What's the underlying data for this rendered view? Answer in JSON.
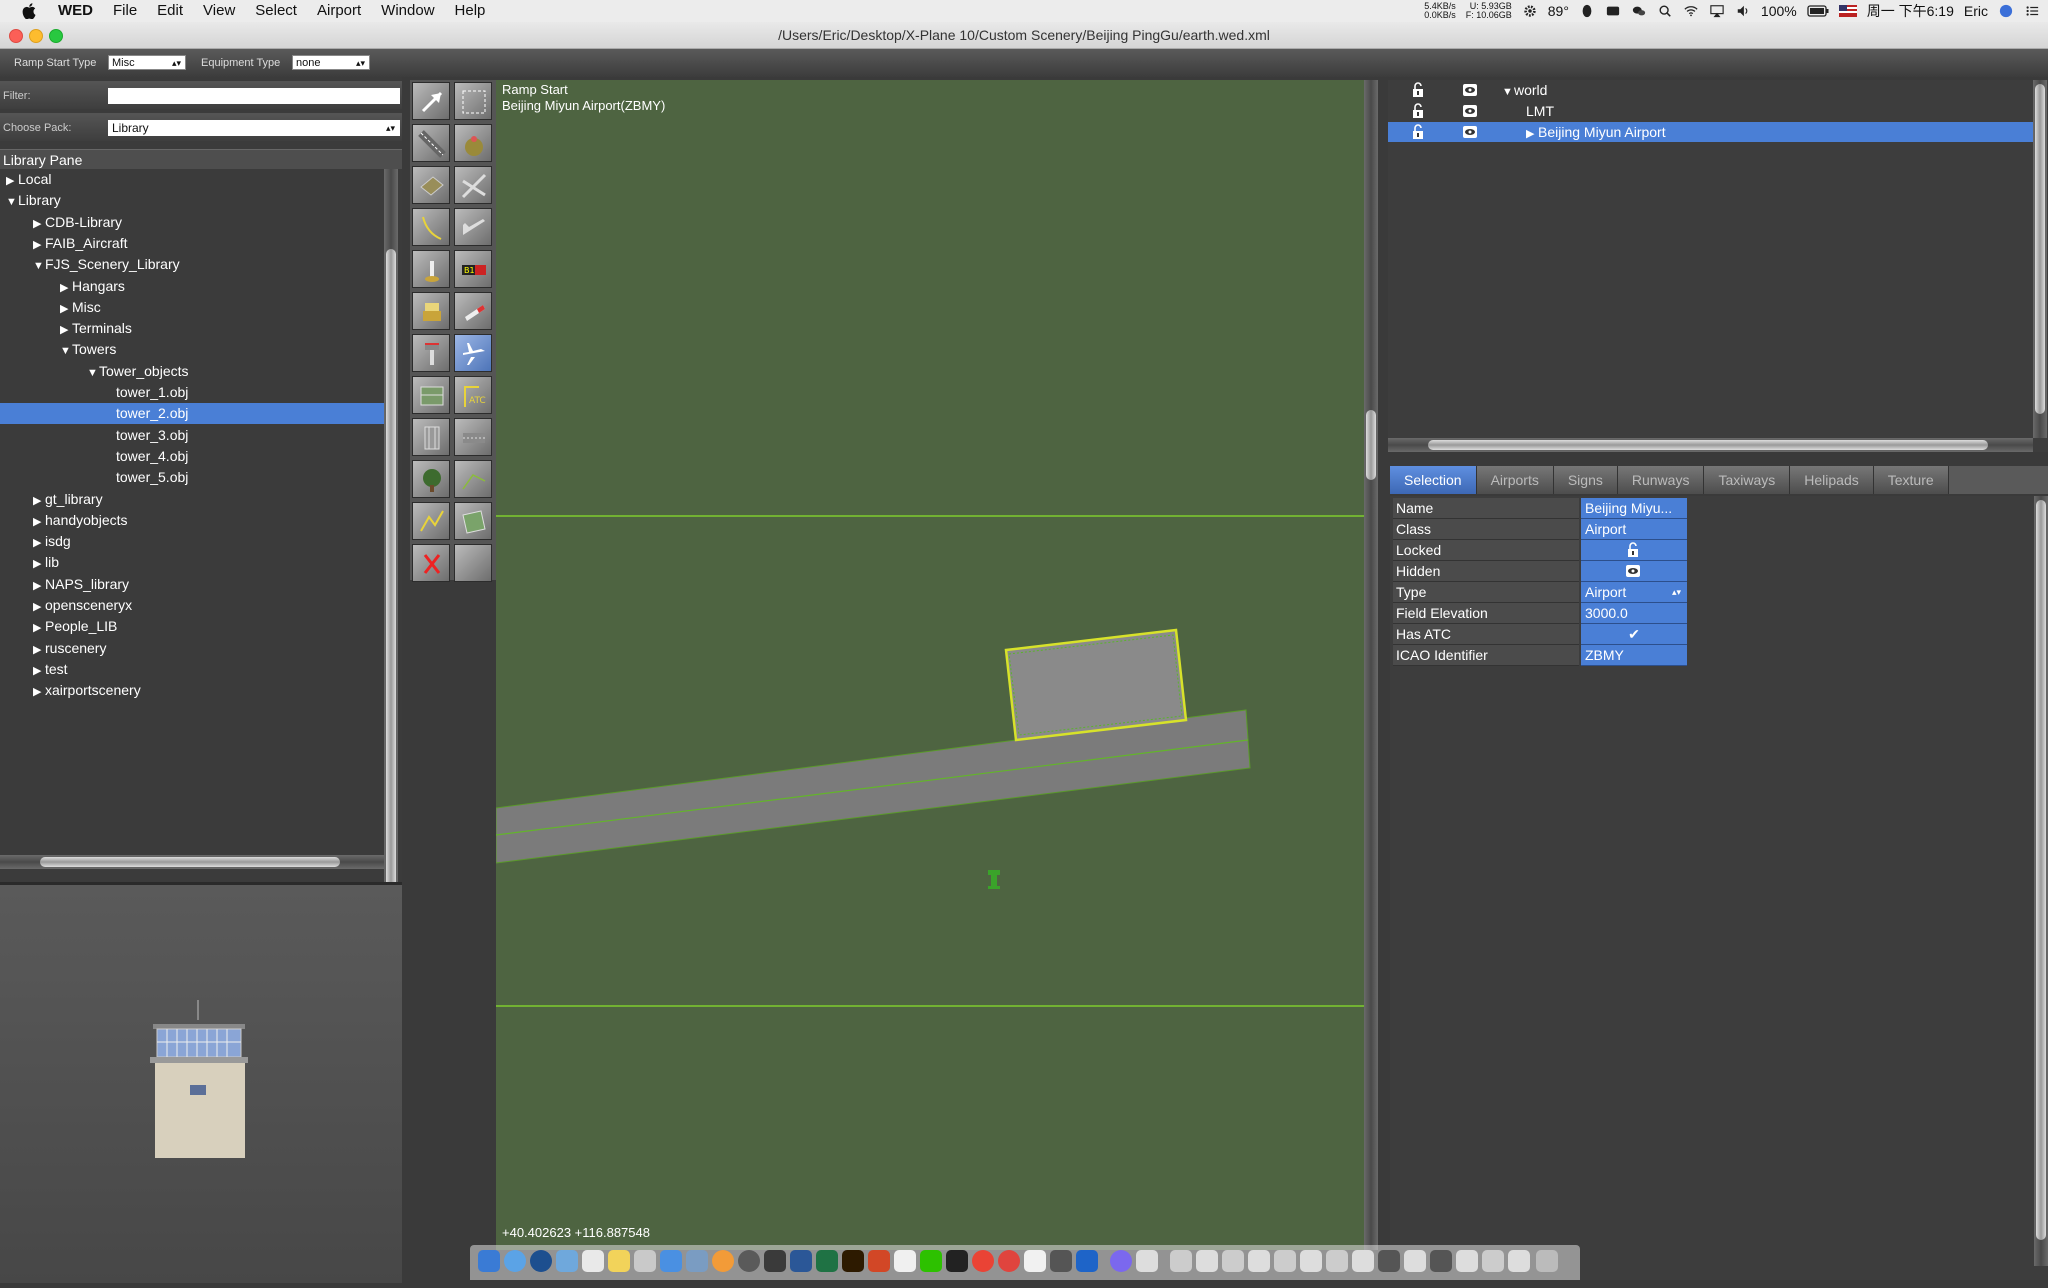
{
  "menubar": {
    "app_name": "WED",
    "items": [
      "File",
      "Edit",
      "View",
      "Select",
      "Airport",
      "Window",
      "Help"
    ],
    "net_up": "5.4KB/s",
    "net_down": "0.0KB/s",
    "disk_u": "U:  5.93GB",
    "disk_f": "F: 10.06GB",
    "temperature": "89°",
    "battery": "100%",
    "clock": "周一 下午6:19",
    "user": "Eric"
  },
  "window": {
    "title": "/Users/Eric/Desktop/X-Plane 10/Custom Scenery/Beijing PingGu/earth.wed.xml"
  },
  "toolbar": {
    "ramp_start_type_label": "Ramp Start Type",
    "ramp_start_type_value": "Misc",
    "equipment_type_label": "Equipment Type",
    "equipment_type_value": "none"
  },
  "library": {
    "filter_label": "Filter:",
    "filter_value": "",
    "pack_label": "Choose Pack:",
    "pack_value": "Library",
    "pane_title": "Library Pane",
    "tree": [
      {
        "label": "Local",
        "depth": 0,
        "state": "collapsed"
      },
      {
        "label": "Library",
        "depth": 0,
        "state": "expanded"
      },
      {
        "label": "CDB-Library",
        "depth": 1,
        "state": "collapsed"
      },
      {
        "label": "FAIB_Aircraft",
        "depth": 1,
        "state": "collapsed"
      },
      {
        "label": "FJS_Scenery_Library",
        "depth": 1,
        "state": "expanded"
      },
      {
        "label": "Hangars",
        "depth": 2,
        "state": "collapsed"
      },
      {
        "label": "Misc",
        "depth": 2,
        "state": "collapsed"
      },
      {
        "label": "Terminals",
        "depth": 2,
        "state": "collapsed"
      },
      {
        "label": "Towers",
        "depth": 2,
        "state": "expanded"
      },
      {
        "label": "Tower_objects",
        "depth": 3,
        "state": "expanded"
      },
      {
        "label": "tower_1.obj",
        "depth": 4,
        "state": "leaf"
      },
      {
        "label": "tower_2.obj",
        "depth": 4,
        "state": "leaf",
        "selected": true
      },
      {
        "label": "tower_3.obj",
        "depth": 4,
        "state": "leaf"
      },
      {
        "label": "tower_4.obj",
        "depth": 4,
        "state": "leaf"
      },
      {
        "label": "tower_5.obj",
        "depth": 4,
        "state": "leaf"
      },
      {
        "label": "gt_library",
        "depth": 1,
        "state": "collapsed"
      },
      {
        "label": "handyobjects",
        "depth": 1,
        "state": "collapsed"
      },
      {
        "label": "isdg",
        "depth": 1,
        "state": "collapsed"
      },
      {
        "label": "lib",
        "depth": 1,
        "state": "collapsed"
      },
      {
        "label": "NAPS_library",
        "depth": 1,
        "state": "collapsed"
      },
      {
        "label": "opensceneryx",
        "depth": 1,
        "state": "collapsed"
      },
      {
        "label": "People_LIB",
        "depth": 1,
        "state": "collapsed"
      },
      {
        "label": "ruscenery",
        "depth": 1,
        "state": "collapsed"
      },
      {
        "label": "test",
        "depth": 1,
        "state": "collapsed"
      },
      {
        "label": "xairportscenery",
        "depth": 1,
        "state": "collapsed"
      }
    ]
  },
  "map": {
    "tool_name": "Ramp Start",
    "airport_name": "Beijing Miyun Airport(ZBMY)",
    "coordinates": "+40.402623 +116.887548"
  },
  "hierarchy": {
    "rows": [
      {
        "label": "world",
        "depth": 0,
        "state": "expanded"
      },
      {
        "label": "LMT",
        "depth": 1,
        "state": "leaf"
      },
      {
        "label": "Beijing Miyun Airport",
        "depth": 1,
        "state": "collapsed",
        "selected": true
      }
    ]
  },
  "tabs": [
    "Selection",
    "Airports",
    "Signs",
    "Runways",
    "Taxiways",
    "Helipads",
    "Texture"
  ],
  "active_tab": "Selection",
  "properties": [
    {
      "name": "Name",
      "value": "Beijing Miyu..."
    },
    {
      "name": "Class",
      "value": "Airport"
    },
    {
      "name": "Locked",
      "value": "",
      "icon": "lock-icon"
    },
    {
      "name": "Hidden",
      "value": "",
      "icon": "eye-icon"
    },
    {
      "name": "Type",
      "value": "Airport",
      "dropdown": true
    },
    {
      "name": "Field Elevation",
      "value": "3000.0"
    },
    {
      "name": "Has ATC",
      "value": "✔"
    },
    {
      "name": "ICAO Identifier",
      "value": "ZBMY"
    }
  ],
  "colors": {
    "selection_blue": "#4a7fd6",
    "map_grass": "#4e6441",
    "panel_dark": "#3b3b3b",
    "outline_green": "#66cc33"
  }
}
